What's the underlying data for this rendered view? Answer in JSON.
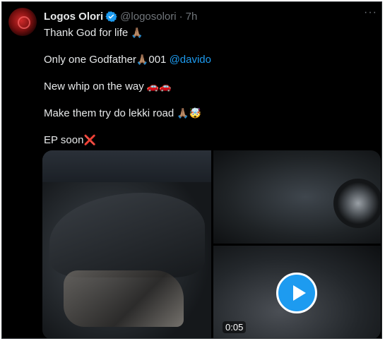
{
  "tweet": {
    "author_name": "Logos Olori",
    "handle": "@logosolori",
    "separator": "·",
    "time": "7h",
    "more_label": "···",
    "lines": {
      "line1_text": "Thank God for life ",
      "line1_emoji": "🙏🏽",
      "line2_text": "Only one Godfather",
      "line2_emoji": "🙏🏽",
      "line2_number": "001 ",
      "line2_mention": "@davido",
      "line3_text": "New whip on the way ",
      "line3_emoji": "🚗🚗",
      "line4_text": "Make them try do lekki road ",
      "line4_emoji": "🙏🏽🤯",
      "line5_text": "EP soon",
      "line5_emoji": "❌"
    },
    "media": {
      "video_duration": "0:05"
    }
  },
  "colors": {
    "background": "#000000",
    "text": "#e7e9ea",
    "muted": "#71767b",
    "accent": "#1d9bf0"
  },
  "icons": [
    "verified-badge-icon",
    "more-options-icon",
    "play-icon"
  ]
}
